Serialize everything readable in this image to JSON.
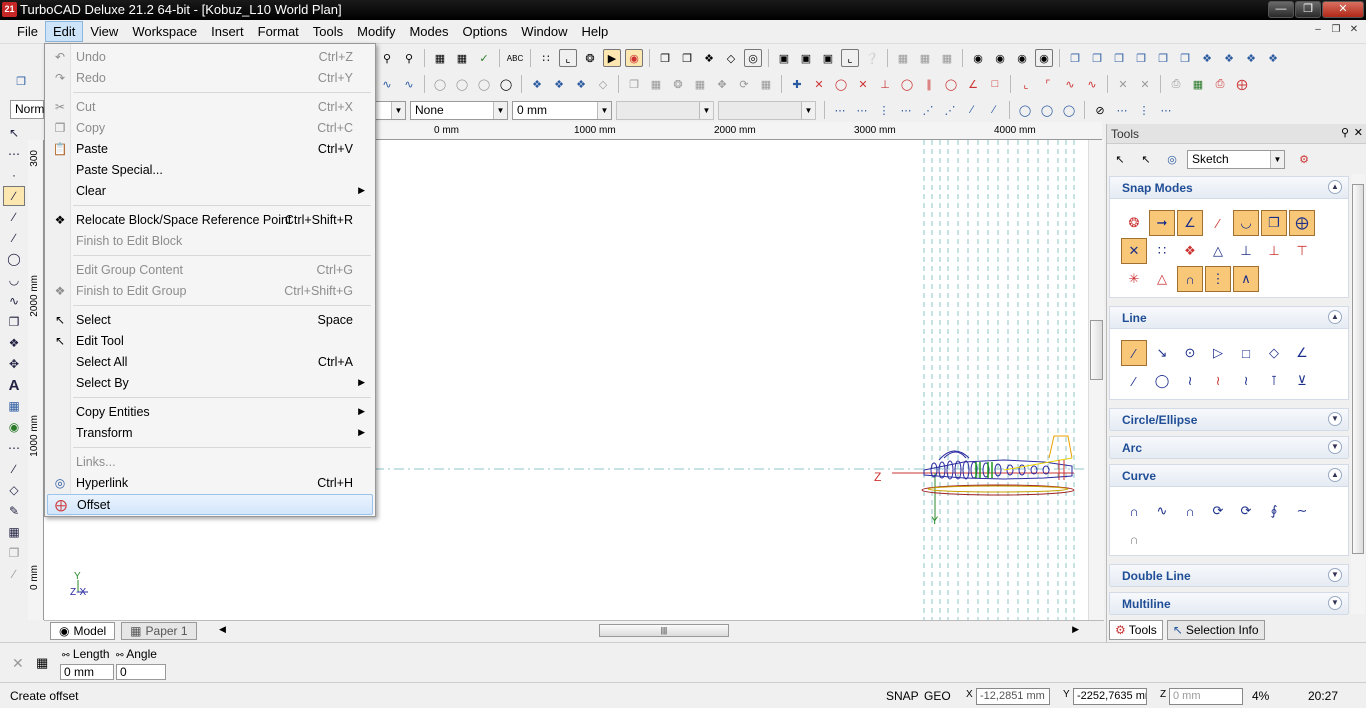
{
  "window": {
    "title": "TurboCAD Deluxe 21.2 64-bit - [Kobuz_L10 World Plan]",
    "app_icon_text": "21"
  },
  "menubar": [
    "File",
    "Edit",
    "View",
    "Workspace",
    "Insert",
    "Format",
    "Tools",
    "Modify",
    "Modes",
    "Options",
    "Window",
    "Help"
  ],
  "toolbar": {
    "style_combo": "Norm",
    "line_pattern_combo": "None",
    "line_width_combo": "0 mm"
  },
  "edit_menu": {
    "undo": {
      "label": "Undo",
      "shortcut": "Ctrl+Z"
    },
    "redo": {
      "label": "Redo",
      "shortcut": "Ctrl+Y"
    },
    "cut": {
      "label": "Cut",
      "shortcut": "Ctrl+X"
    },
    "copy": {
      "label": "Copy",
      "shortcut": "Ctrl+C"
    },
    "paste": {
      "label": "Paste",
      "shortcut": "Ctrl+V"
    },
    "paste_special": {
      "label": "Paste Special..."
    },
    "clear": {
      "label": "Clear"
    },
    "relocate": {
      "label": "Relocate Block/Space Reference Point",
      "shortcut": "Ctrl+Shift+R"
    },
    "finish_block": {
      "label": "Finish to Edit Block"
    },
    "edit_group": {
      "label": "Edit Group Content",
      "shortcut": "Ctrl+G"
    },
    "finish_group": {
      "label": "Finish to Edit Group",
      "shortcut": "Ctrl+Shift+G"
    },
    "select": {
      "label": "Select",
      "shortcut": "Space"
    },
    "edit_tool": {
      "label": "Edit Tool"
    },
    "select_all": {
      "label": "Select All",
      "shortcut": "Ctrl+A"
    },
    "select_by": {
      "label": "Select By"
    },
    "copy_entities": {
      "label": "Copy Entities"
    },
    "transform": {
      "label": "Transform"
    },
    "links": {
      "label": "Links..."
    },
    "hyperlink": {
      "label": "Hyperlink",
      "shortcut": "Ctrl+H"
    },
    "offset": {
      "label": "Offset"
    }
  },
  "rulers": {
    "top": [
      "0 mm",
      "1000 mm",
      "2000 mm",
      "3000 mm",
      "4000 mm"
    ],
    "left": [
      "300",
      "2000 mm",
      "1000 mm",
      "0 mm"
    ]
  },
  "canvas": {
    "axis_z": "Z",
    "axis_y": "Y",
    "ucs_y": "Y",
    "ucs_zx": "Z-X"
  },
  "page_tabs": [
    "Model",
    "Paper 1"
  ],
  "tools_panel": {
    "title": "Tools",
    "mode_combo": "Sketch",
    "sections": {
      "snap_modes": "Snap Modes",
      "line": "Line",
      "circle_ellipse": "Circle/Ellipse",
      "arc": "Arc",
      "curve": "Curve",
      "double_line": "Double Line",
      "multiline": "Multiline"
    },
    "tabs": [
      "Tools",
      "Selection Info"
    ]
  },
  "inspector": {
    "length_label": "Length",
    "angle_label": "Angle",
    "length_value": "0 mm",
    "angle_value": "0"
  },
  "status": {
    "prompt": "Create offset",
    "snap": "SNAP",
    "geo": "GEO",
    "x_value": "-12,2851 mm",
    "y_value": "-2252,7635 mr",
    "z_value": "0 mm",
    "zoom": "4%",
    "time": "20:27"
  },
  "colors": {
    "snap_active": "#f8c878",
    "section_title": "#1f4e96",
    "menu_highlight": "#d2e6fb"
  }
}
